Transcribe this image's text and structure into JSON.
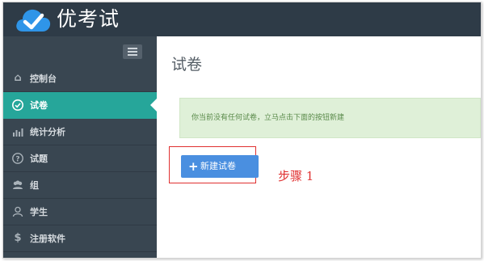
{
  "app": {
    "title": "优考试",
    "brand_color": "#2e3b47",
    "accent_color": "#26a69a"
  },
  "sidebar": {
    "collapse_icon": "menu-icon",
    "items": [
      {
        "label": "控制台",
        "icon": "home-icon",
        "active": false
      },
      {
        "label": "试卷",
        "icon": "check-circle-icon",
        "active": true
      },
      {
        "label": "统计分析",
        "icon": "bar-chart-icon",
        "active": false
      },
      {
        "label": "试题",
        "icon": "question-circle-icon",
        "active": false
      },
      {
        "label": "组",
        "icon": "users-icon",
        "active": false
      },
      {
        "label": "学生",
        "icon": "user-icon",
        "active": false
      },
      {
        "label": "注册软件",
        "icon": "dollar-icon",
        "active": false
      }
    ]
  },
  "main": {
    "page_title": "试卷",
    "alert_text": "你当前没有任何试卷，立马点击下面的按钮新建",
    "new_button_label": "新建试卷",
    "step_label": "步骤 1"
  }
}
